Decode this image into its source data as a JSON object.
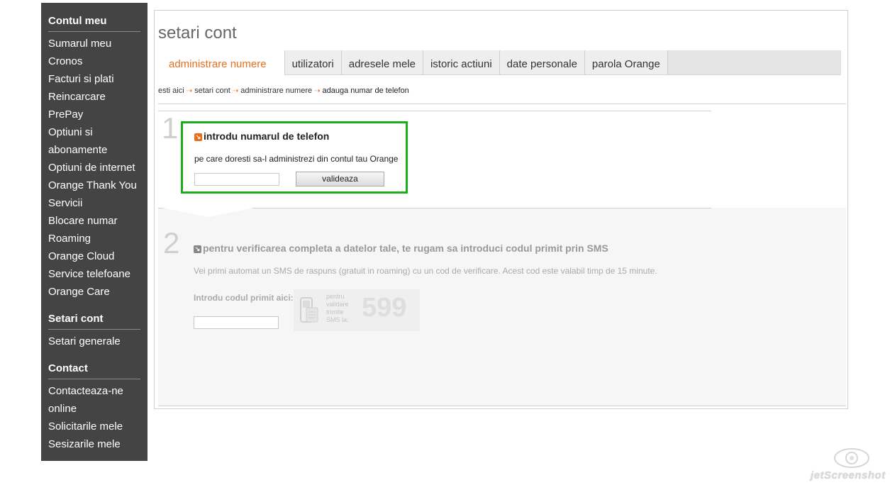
{
  "sidebar": {
    "sections": [
      {
        "heading": "Contul meu",
        "items": [
          "Sumarul meu",
          "Cronos",
          "Facturi si plati",
          "Reincarcare",
          "PrePay",
          "Optiuni si",
          "abonamente",
          "Optiuni de internet",
          "Orange Thank You",
          "Servicii",
          "Blocare numar",
          "Roaming",
          "Orange Cloud",
          "Service telefoane",
          "Orange Care"
        ]
      },
      {
        "heading": "Setari cont",
        "items": [
          "Setari generale"
        ]
      },
      {
        "heading": "Contact",
        "items": [
          "Contacteaza-ne",
          "online",
          "Solicitarile mele",
          "Sesizarile mele"
        ]
      }
    ]
  },
  "page": {
    "title": "setari cont",
    "tabs": [
      {
        "label": "administrare numere",
        "active": true
      },
      {
        "label": "utilizatori",
        "active": false
      },
      {
        "label": "adresele mele",
        "active": false
      },
      {
        "label": "istoric actiuni",
        "active": false
      },
      {
        "label": "date personale",
        "active": false
      },
      {
        "label": "parola Orange",
        "active": false
      }
    ],
    "breadcrumb": [
      "esti aici",
      "setari cont",
      "administrare numere",
      "adauga numar de telefon"
    ]
  },
  "step1": {
    "number": "1",
    "title": "introdu numarul de telefon",
    "subtitle": "pe care doresti sa-l administrezi din contul tau Orange",
    "phone_value": "",
    "button_label": "valideaza"
  },
  "step2": {
    "number": "2",
    "title": "pentru verificarea completa a datelor tale, te rugam sa introduci codul primit prin SMS",
    "subtitle": "Vei primi automat un SMS de raspuns (gratuit in roaming) cu un cod de verificare. Acest cod este valabil timp de 15 minute.",
    "code_label": "Introdu codul primit aici:",
    "code_value": "",
    "sms_hint": "pentru validare trimite SMS la:",
    "sms_number": "599"
  },
  "watermark": {
    "text": "jetScreenshot"
  },
  "colors": {
    "sidebar_bg": "#444444",
    "accent_orange": "#e86e1c",
    "highlight_green": "#1aaf1a"
  }
}
